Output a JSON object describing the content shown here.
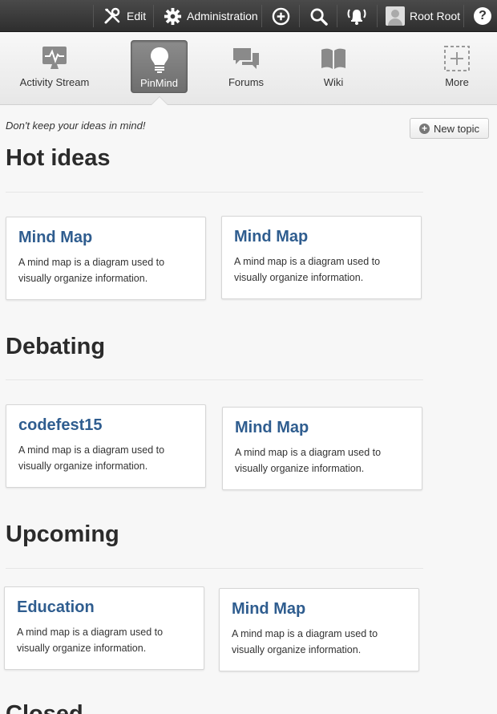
{
  "topbar": {
    "edit_label": "Edit",
    "administration_label": "Administration",
    "user_name": "Root Root",
    "help_label": "?"
  },
  "appnav": {
    "items": [
      {
        "label": "Activity Stream",
        "icon": "activity-stream-icon"
      },
      {
        "label": "PinMind",
        "icon": "lightbulb-icon",
        "active": true
      },
      {
        "label": "Forums",
        "icon": "forums-icon"
      },
      {
        "label": "Wiki",
        "icon": "wiki-book-icon"
      },
      {
        "label": "More",
        "icon": "more-plus-icon"
      }
    ]
  },
  "page": {
    "tagline": "Don't keep your ideas in mind!",
    "new_topic_label": "New topic"
  },
  "sections": [
    {
      "title": "Hot ideas",
      "cards": [
        {
          "title": "Mind Map",
          "desc": "A mind map is a diagram used to visually organize information."
        },
        {
          "title": "Mind Map",
          "desc": "A mind map is a diagram used to visually organize information."
        }
      ]
    },
    {
      "title": "Debating",
      "cards": [
        {
          "title": "codefest15",
          "desc": "A mind map is a diagram used to visually organize information."
        },
        {
          "title": "Mind Map",
          "desc": "A mind map is a diagram used to visually organize information."
        }
      ]
    },
    {
      "title": "Upcoming",
      "cards": [
        {
          "title": "Education",
          "desc": "A mind map is a diagram used to visually organize information."
        },
        {
          "title": "Mind Map",
          "desc": "A mind map is a diagram used to visually organize information."
        }
      ]
    },
    {
      "title": "Closed",
      "cards": []
    }
  ],
  "colors": {
    "card_title": "#2f5d8f",
    "topbar_bg": "#3a3a3a",
    "active_tab_bg": "#7d7d7d"
  }
}
